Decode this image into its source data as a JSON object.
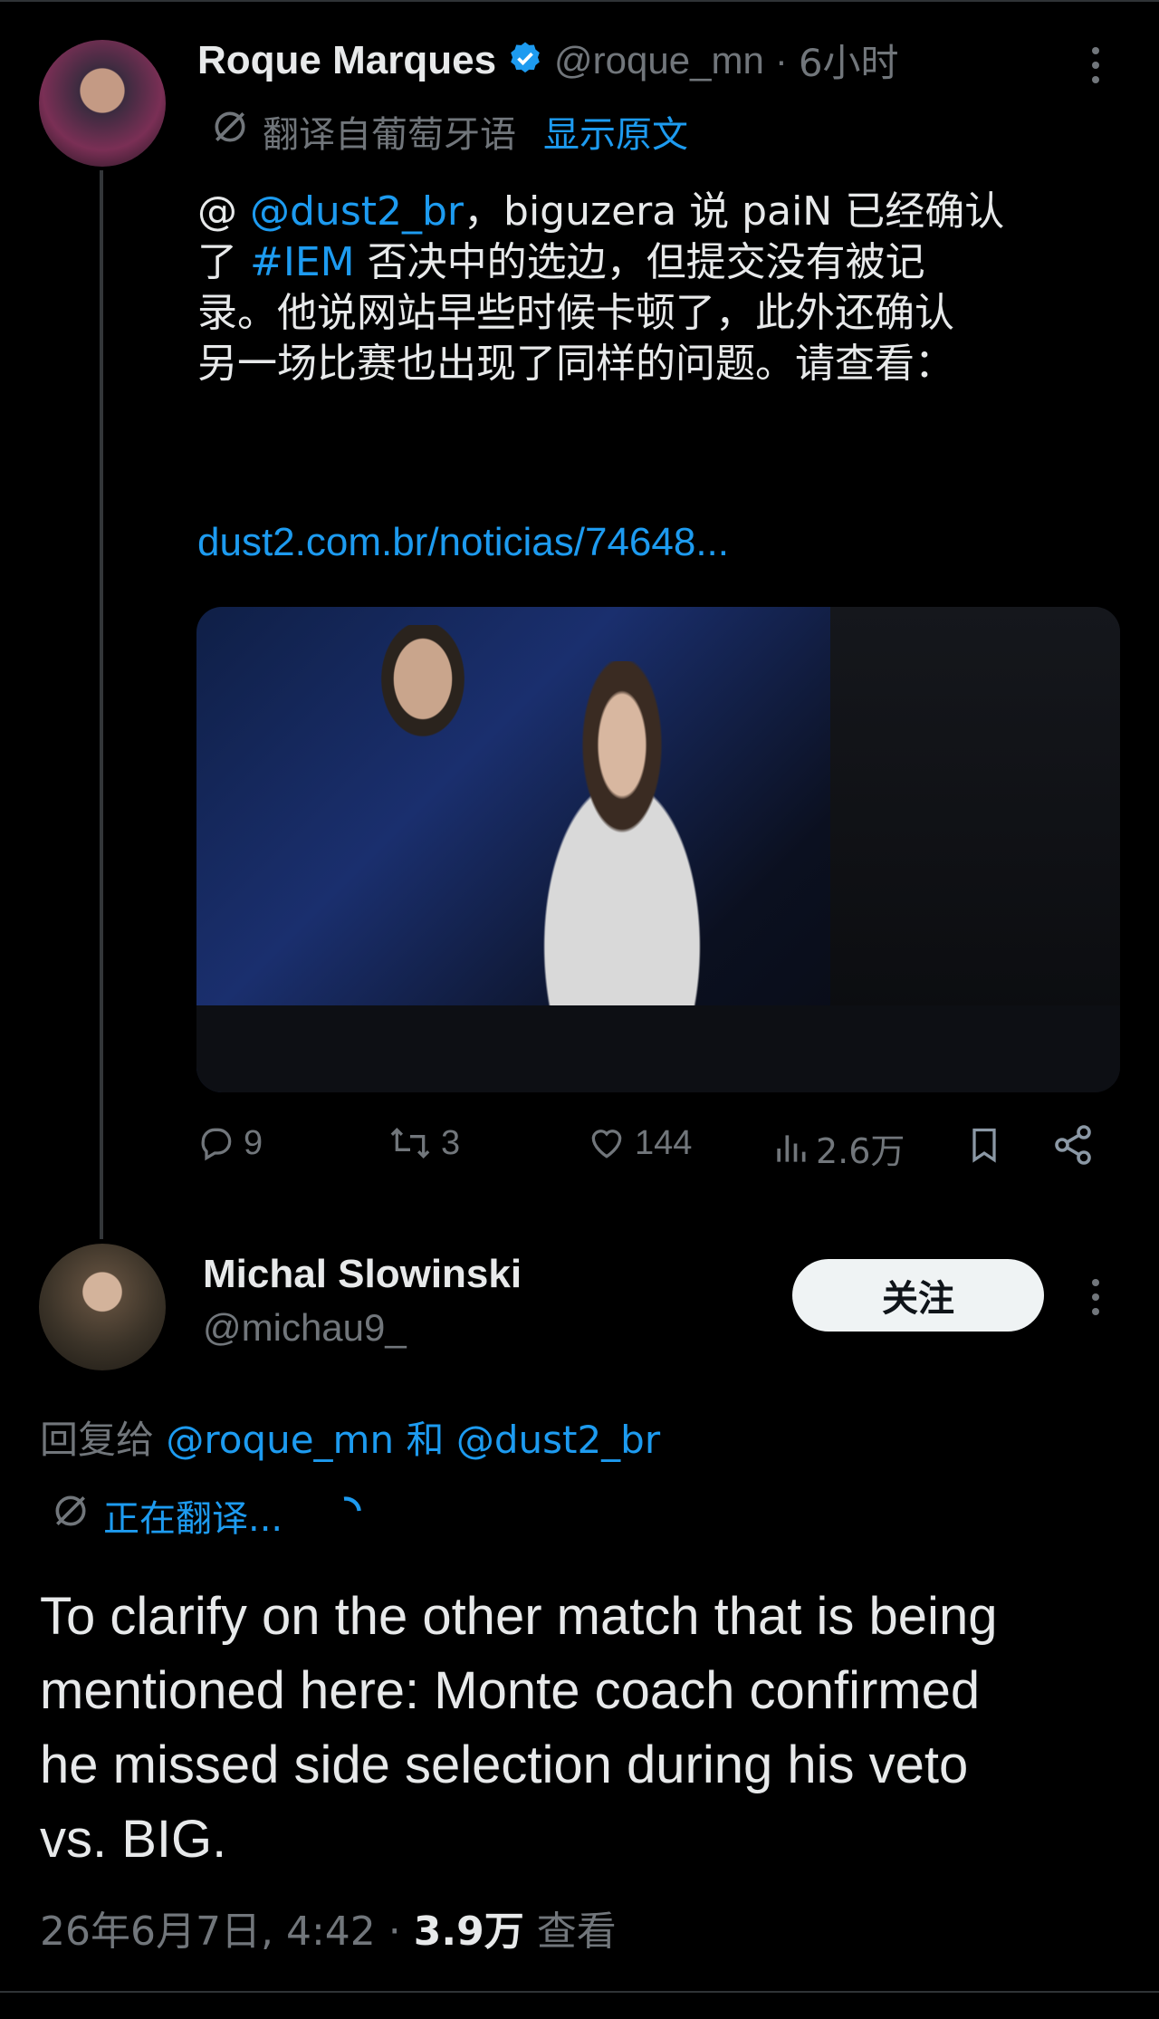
{
  "tweet": {
    "author_name": "Roque Marques",
    "author_handle": "@roque_mn",
    "time_sep": "·",
    "time": "6小时",
    "translate_label": "翻译自葡萄牙语",
    "show_original": "显示原文",
    "body": {
      "mention_at": "@",
      "mention": "@dust2_br",
      "text_a": "，biguzera 说 paiN 已经确认\n了 ",
      "hashtag": "#IEM",
      "text_b": " 否决中的选边，但提交没有被记\n录。他说网站早些时候卡顿了，此外还确认\n另一场比赛也出现了同样的问题。请查看：",
      "link": "dust2.com.br/noticias/74648..."
    },
    "actions": {
      "replies": "9",
      "retweets": "3",
      "likes": "144",
      "views": "2.6万"
    }
  },
  "reply": {
    "author_name": "Michal Slowinski",
    "author_handle": "@michau9_",
    "follow_label": "关注",
    "reply_to_prefix": "回复给",
    "reply_to_1": "@roque_mn",
    "reply_to_and": "和",
    "reply_to_2": "@dust2_br",
    "translating": "正在翻译...",
    "body": "To clarify on the other match that is being\nmentioned here: Monte coach confirmed\nhe missed side selection during his veto\nvs. BIG.",
    "timestamp": "26年6月7日, 4:42",
    "meta_sep": "·",
    "views_count": "3.9万",
    "views_label": "查看"
  },
  "colors": {
    "background": "#000000",
    "text": "#e7e9ea",
    "muted": "#71767b",
    "accent": "#1d9bf0"
  },
  "icons": [
    "verified-badge-icon",
    "translate-icon",
    "more-icon",
    "reply-icon",
    "retweet-icon",
    "like-icon",
    "views-icon",
    "bookmark-icon",
    "share-icon",
    "loading-spinner-icon"
  ]
}
